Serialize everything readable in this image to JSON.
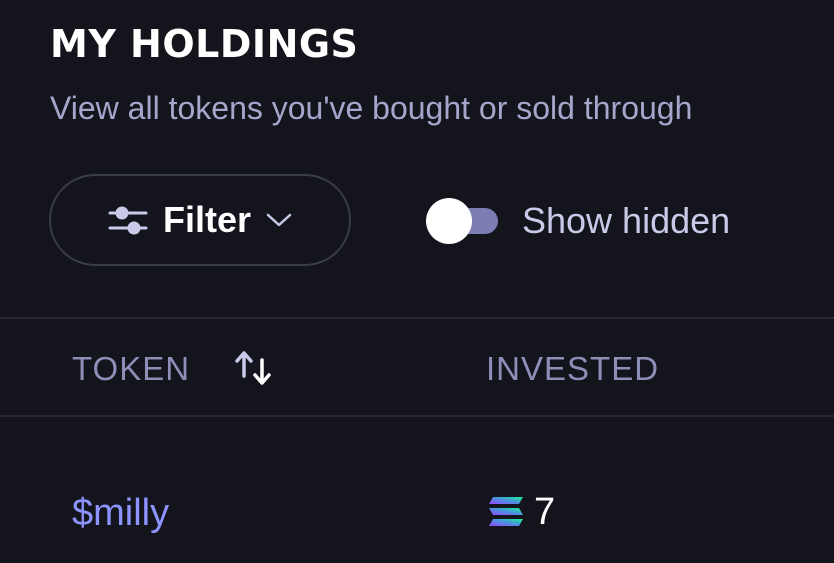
{
  "header": {
    "title": "MY HOLDINGS",
    "subtitle": "View all tokens you've bought or sold through"
  },
  "controls": {
    "filter_label": "Filter",
    "filter_icon": "sliders-icon",
    "filter_chevron": "chevron-down-icon",
    "show_hidden_label": "Show hidden",
    "show_hidden_enabled": false
  },
  "table": {
    "columns": [
      {
        "label": "TOKEN",
        "sortable": true,
        "sort_icon": "sort-arrows-icon"
      },
      {
        "label": "INVESTED"
      }
    ],
    "rows": [
      {
        "token": "$milly",
        "invested": "7",
        "currency_icon": "solana-icon"
      }
    ]
  },
  "colors": {
    "background": "#13141c",
    "accent": "#8d93ff",
    "muted_text": "#a5a6cc",
    "border": "#3a3b48"
  }
}
